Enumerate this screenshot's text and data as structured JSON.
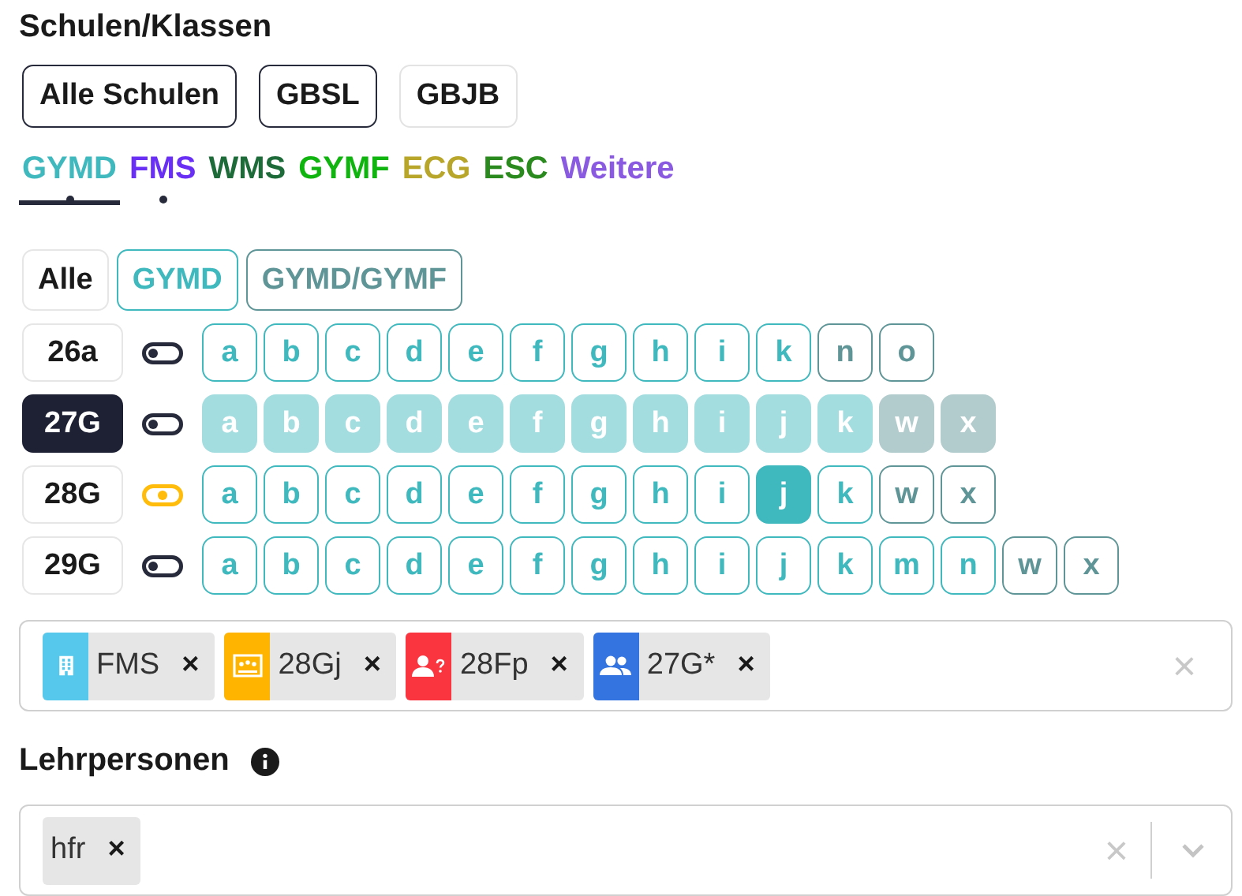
{
  "schools_heading": "Schulen/Klassen",
  "schools": [
    {
      "label": "Alle Schulen",
      "selected": true
    },
    {
      "label": "GBSL",
      "selected": true
    },
    {
      "label": "GBJB",
      "selected": false
    }
  ],
  "departments": [
    {
      "label": "GYMD",
      "color": "#3fb8be",
      "selected": true,
      "dot": true
    },
    {
      "label": "FMS",
      "color": "#6a2ff5",
      "selected": false,
      "dot": true
    },
    {
      "label": "WMS",
      "color": "#1e6b3a",
      "selected": false,
      "dot": false
    },
    {
      "label": "GYMF",
      "color": "#10b40e",
      "selected": false,
      "dot": false
    },
    {
      "label": "ECG",
      "color": "#b8a62a",
      "selected": false,
      "dot": false
    },
    {
      "label": "ESC",
      "color": "#2a8a1e",
      "selected": false,
      "dot": false
    },
    {
      "label": "Weitere",
      "color": "#8a5ae0",
      "selected": false,
      "dot": false
    }
  ],
  "filters": [
    {
      "label": "Alle",
      "color": "#1a1a1a"
    },
    {
      "label": "GYMD",
      "color": "#3fb8be"
    },
    {
      "label": "GYMD/GYMF",
      "color": "#5f9597"
    }
  ],
  "classes": [
    {
      "label": "26a",
      "selected": false,
      "partial": false,
      "letters": [
        {
          "label": "a",
          "kind": "gymd",
          "selected": false
        },
        {
          "label": "b",
          "kind": "gymd",
          "selected": false
        },
        {
          "label": "c",
          "kind": "gymd",
          "selected": false
        },
        {
          "label": "d",
          "kind": "gymd",
          "selected": false
        },
        {
          "label": "e",
          "kind": "gymd",
          "selected": false
        },
        {
          "label": "f",
          "kind": "gymd",
          "selected": false
        },
        {
          "label": "g",
          "kind": "gymd",
          "selected": false
        },
        {
          "label": "h",
          "kind": "gymd",
          "selected": false
        },
        {
          "label": "i",
          "kind": "gymd",
          "selected": false
        },
        {
          "label": "k",
          "kind": "gymd",
          "selected": false
        },
        {
          "label": "n",
          "kind": "bilingual",
          "selected": false
        },
        {
          "label": "o",
          "kind": "bilingual",
          "selected": false
        }
      ]
    },
    {
      "label": "27G",
      "selected": true,
      "partial": false,
      "letters": [
        {
          "label": "a",
          "kind": "gymd",
          "selected": false
        },
        {
          "label": "b",
          "kind": "gymd",
          "selected": false
        },
        {
          "label": "c",
          "kind": "gymd",
          "selected": false
        },
        {
          "label": "d",
          "kind": "gymd",
          "selected": false
        },
        {
          "label": "e",
          "kind": "gymd",
          "selected": false
        },
        {
          "label": "f",
          "kind": "gymd",
          "selected": false
        },
        {
          "label": "g",
          "kind": "gymd",
          "selected": false
        },
        {
          "label": "h",
          "kind": "gymd",
          "selected": false
        },
        {
          "label": "i",
          "kind": "gymd",
          "selected": false
        },
        {
          "label": "j",
          "kind": "gymd",
          "selected": false
        },
        {
          "label": "k",
          "kind": "gymd",
          "selected": false
        },
        {
          "label": "w",
          "kind": "bilingual",
          "selected": false
        },
        {
          "label": "x",
          "kind": "bilingual",
          "selected": false
        }
      ]
    },
    {
      "label": "28G",
      "selected": false,
      "partial": true,
      "letters": [
        {
          "label": "a",
          "kind": "gymd",
          "selected": false
        },
        {
          "label": "b",
          "kind": "gymd",
          "selected": false
        },
        {
          "label": "c",
          "kind": "gymd",
          "selected": false
        },
        {
          "label": "d",
          "kind": "gymd",
          "selected": false
        },
        {
          "label": "e",
          "kind": "gymd",
          "selected": false
        },
        {
          "label": "f",
          "kind": "gymd",
          "selected": false
        },
        {
          "label": "g",
          "kind": "gymd",
          "selected": false
        },
        {
          "label": "h",
          "kind": "gymd",
          "selected": false
        },
        {
          "label": "i",
          "kind": "gymd",
          "selected": false
        },
        {
          "label": "j",
          "kind": "gymd",
          "selected": true
        },
        {
          "label": "k",
          "kind": "gymd",
          "selected": false
        },
        {
          "label": "w",
          "kind": "bilingual",
          "selected": false
        },
        {
          "label": "x",
          "kind": "bilingual",
          "selected": false
        }
      ]
    },
    {
      "label": "29G",
      "selected": false,
      "partial": false,
      "letters": [
        {
          "label": "a",
          "kind": "gymd",
          "selected": false
        },
        {
          "label": "b",
          "kind": "gymd",
          "selected": false
        },
        {
          "label": "c",
          "kind": "gymd",
          "selected": false
        },
        {
          "label": "d",
          "kind": "gymd",
          "selected": false
        },
        {
          "label": "e",
          "kind": "gymd",
          "selected": false
        },
        {
          "label": "f",
          "kind": "gymd",
          "selected": false
        },
        {
          "label": "g",
          "kind": "gymd",
          "selected": false
        },
        {
          "label": "h",
          "kind": "gymd",
          "selected": false
        },
        {
          "label": "i",
          "kind": "gymd",
          "selected": false
        },
        {
          "label": "j",
          "kind": "gymd",
          "selected": false
        },
        {
          "label": "k",
          "kind": "gymd",
          "selected": false
        },
        {
          "label": "m",
          "kind": "gymd",
          "selected": false
        },
        {
          "label": "n",
          "kind": "gymd",
          "selected": false
        },
        {
          "label": "w",
          "kind": "bilingual",
          "selected": false
        },
        {
          "label": "x",
          "kind": "bilingual",
          "selected": false
        }
      ]
    }
  ],
  "class_tags": [
    {
      "kind": "building",
      "color": "#55c8ec",
      "label": "FMS",
      "remove": "×"
    },
    {
      "kind": "classroom",
      "color": "#ffb400",
      "label": "28Gj",
      "remove": "×"
    },
    {
      "kind": "person-question",
      "color": "#fb3540",
      "label": "28Fp",
      "remove": "×"
    },
    {
      "kind": "people",
      "color": "#3474e0",
      "label": "27G*",
      "remove": "×"
    }
  ],
  "class_clear": "×",
  "teachers_heading": "Lehrpersonen",
  "teacher_tags": [
    {
      "label": "hfr",
      "remove": "×"
    }
  ],
  "teacher_clear": "×"
}
